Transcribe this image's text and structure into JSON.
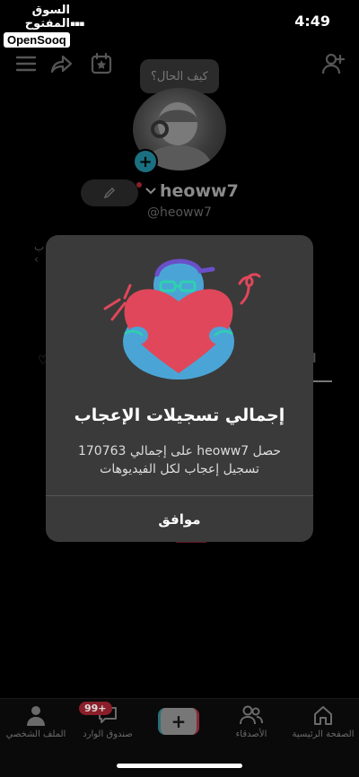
{
  "status_bar": {
    "time": "4:49",
    "watermark_ar": "السوق المفتوح",
    "watermark_en": "OpenSooq"
  },
  "profile": {
    "bubble_text": "كيف الحال؟",
    "username": "heoww7",
    "handle": "@heoww7"
  },
  "modal": {
    "title": "إجمالي تسجيلات الإعجاب",
    "body": "حصل heoww7 على إجمالي 170763 تسجيل إعجاب لكل الفيديوهات",
    "ok_label": "موافق"
  },
  "bottom_nav": {
    "items": [
      {
        "label": "الصفحة الرئيسية",
        "icon": "home-icon"
      },
      {
        "label": "الأصدقاء",
        "icon": "friends-icon"
      },
      {
        "label": "",
        "icon": "plus-icon"
      },
      {
        "label": "صندوق الوارد",
        "icon": "inbox-icon"
      },
      {
        "label": "الملف الشخصي",
        "icon": "person-icon"
      }
    ],
    "inbox_badge": "99+"
  },
  "colors": {
    "modal_bg": "#3a3a3a",
    "heart": "#e0475a",
    "character": "#4aa5d6",
    "accent_pink": "#e0475a"
  }
}
